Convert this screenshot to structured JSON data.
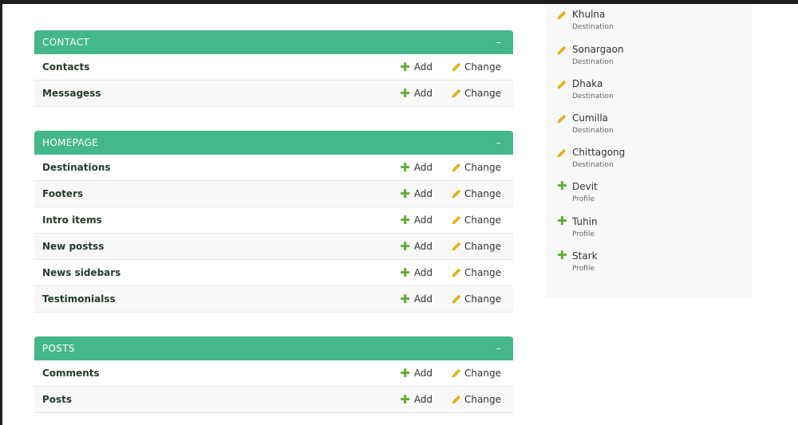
{
  "modules": [
    {
      "title": "CONTACT",
      "toggle": "–",
      "models": [
        {
          "name": "Contacts",
          "add": "Add",
          "change": "Change"
        },
        {
          "name": "Messagess",
          "add": "Add",
          "change": "Change"
        }
      ]
    },
    {
      "title": "HOMEPAGE",
      "toggle": "–",
      "models": [
        {
          "name": "Destinations",
          "add": "Add",
          "change": "Change"
        },
        {
          "name": "Footers",
          "add": "Add",
          "change": "Change"
        },
        {
          "name": "Intro items",
          "add": "Add",
          "change": "Change"
        },
        {
          "name": "New postss",
          "add": "Add",
          "change": "Change"
        },
        {
          "name": "News sidebars",
          "add": "Add",
          "change": "Change"
        },
        {
          "name": "Testimonialss",
          "add": "Add",
          "change": "Change"
        }
      ]
    },
    {
      "title": "POSTS",
      "toggle": "–",
      "models": [
        {
          "name": "Comments",
          "add": "Add",
          "change": "Change"
        },
        {
          "name": "Posts",
          "add": "Add",
          "change": "Change"
        }
      ]
    }
  ],
  "recent_actions": [
    {
      "name": "Khulna",
      "type": "Destination",
      "action": "change",
      "icon": "pencil-icon"
    },
    {
      "name": "Sonargaon",
      "type": "Destination",
      "action": "change",
      "icon": "pencil-icon"
    },
    {
      "name": "Dhaka",
      "type": "Destination",
      "action": "change",
      "icon": "pencil-icon"
    },
    {
      "name": "Cumilla",
      "type": "Destination",
      "action": "change",
      "icon": "pencil-icon"
    },
    {
      "name": "Chittagong",
      "type": "Destination",
      "action": "change",
      "icon": "pencil-icon"
    },
    {
      "name": "Devit",
      "type": "Profile",
      "action": "add",
      "icon": "plus-icon"
    },
    {
      "name": "Tuhin",
      "type": "Profile",
      "action": "add",
      "icon": "plus-icon"
    },
    {
      "name": "Stark",
      "type": "Profile",
      "action": "add",
      "icon": "plus-icon"
    }
  ],
  "colors": {
    "header_bg": "#44b78b",
    "add_icon": "#5fad32",
    "change_icon": "#efb80b",
    "model_link": "#263b2d"
  }
}
